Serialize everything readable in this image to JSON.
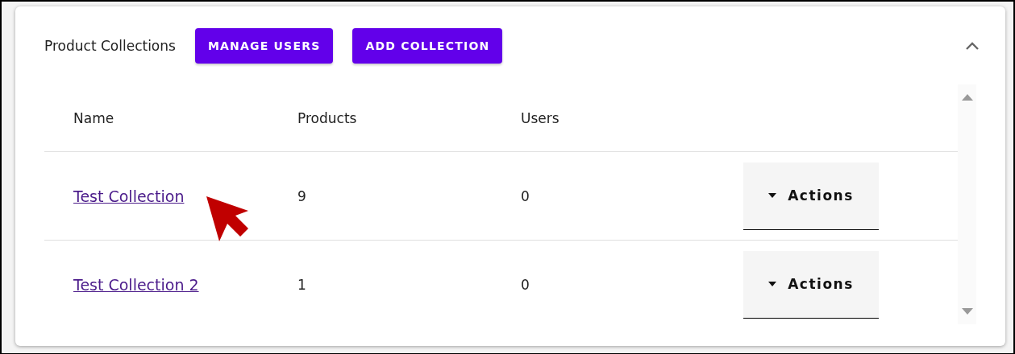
{
  "panel": {
    "title": "Product Collections",
    "expanded": true,
    "buttons": [
      "MANAGE USERS",
      "ADD COLLECTION"
    ]
  },
  "table": {
    "columns": [
      "Name",
      "Products",
      "Users"
    ],
    "rows": [
      {
        "name": "Test Collection",
        "products": "9",
        "users": "0",
        "action": "Actions"
      },
      {
        "name": "Test Collection 2",
        "products": "1",
        "users": "0",
        "action": "Actions"
      }
    ]
  }
}
